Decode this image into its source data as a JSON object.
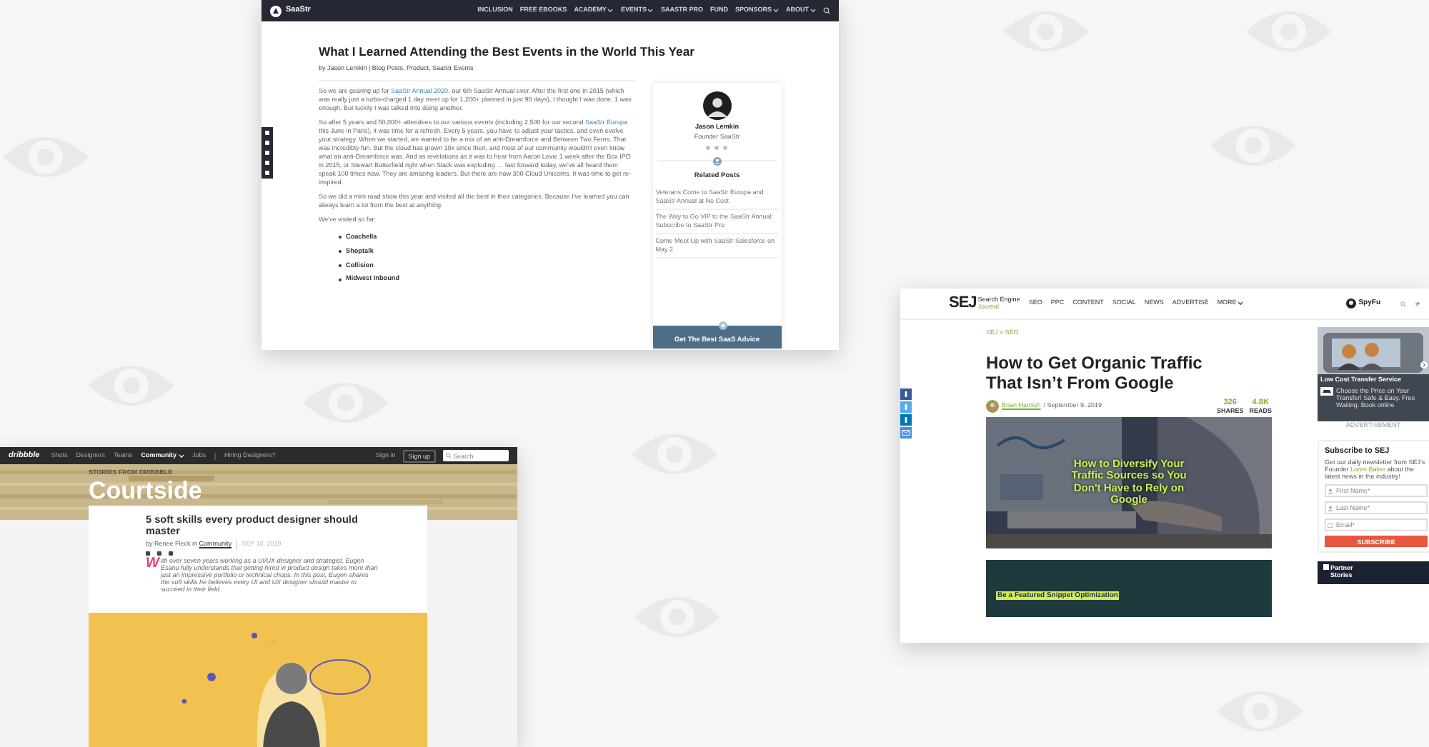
{
  "saastr": {
    "logo": "SaaStr",
    "nav": [
      {
        "label": "INCLUSION",
        "dropdown": false
      },
      {
        "label": "FREE EBOOKS",
        "dropdown": false
      },
      {
        "label": "ACADEMY",
        "dropdown": true
      },
      {
        "label": "EVENTS",
        "dropdown": true
      },
      {
        "label": "SAASTR PRO",
        "dropdown": false
      },
      {
        "label": "FUND",
        "dropdown": false
      },
      {
        "label": "SPONSORS",
        "dropdown": true
      },
      {
        "label": "ABOUT",
        "dropdown": true
      }
    ],
    "title": "What I Learned Attending the Best Events in the World This Year",
    "byline": "by Jason Lemkin | Blog Posts, Product, SaaStr Events",
    "paragraphs": [
      [
        {
          "text": "So we are gearing up for ",
          "link": false
        },
        {
          "text": "SaaStr Annual 2020",
          "link": true
        },
        {
          "text": ", our 6th SaaStr Annual ever.  After the first one in 2015 (which was really just a turbo-charged 1 day meet up for 1,200+ planned in just 90 days), I thought I was done.  1 was enough.  But luckily I was talked into doing another.",
          "link": false
        }
      ],
      [
        {
          "text": "So after 5 years and 50,000+ attendees to our various events (including 2,500 for our second ",
          "link": false
        },
        {
          "text": "SaaStr Europa",
          "link": true
        },
        {
          "text": " this June in Paris), it was time for a refresh.  Every 5 years, you have to adjust your tactics, and even evolve your strategy.  When we started, we wanted to be a mix of an anti-Dreamforce and Between Two Ferns.  That was incredibly fun.  But the cloud has grown 10x since then, and most of our community wouldn't even know what an anti-Dreamforce was.  And as revelations as it was to hear from Aaron Levie 1 week after the Box IPO in 2015, or Stewart Butterfield right when Slack was exploding … fast forward today, we've all heard them speak 100 times now.  They are amazing leaders.  But there are now 300 Cloud Unicorns.  It was time to get re-inspired.",
          "link": false
        }
      ],
      [
        {
          "text": "So we did a mini road show this year and visited all the best in their categories.  Because I've learned you can always learn a lot from the best at anything.",
          "link": false
        }
      ],
      [
        {
          "text": "We've visited so far:",
          "link": false
        }
      ]
    ],
    "list": [
      "Coachella",
      "Shoptalk",
      "Collision",
      "Midwest Inbound"
    ],
    "author": {
      "name": "Jason Lemkin",
      "role": "Founder SaaStr"
    },
    "related_title": "Related Posts",
    "related_posts": [
      "Veterans Come to SaaStr Europa and SaaStr Annual at No Cost",
      "The Way to Go VIP to the SaaStr Annual: Subscribe to SaaStr Pro",
      "Come Meet Up with SaaStr Salesforce on May 2"
    ],
    "banner": "Get The Best SaaS Advice"
  },
  "dribbble": {
    "logo": "dribbble",
    "nav": [
      {
        "label": "Shots",
        "selected": false,
        "dropdown": false
      },
      {
        "label": "Designers",
        "selected": false,
        "dropdown": false
      },
      {
        "label": "Teams",
        "selected": false,
        "dropdown": false
      },
      {
        "label": "Community",
        "selected": true,
        "dropdown": true
      },
      {
        "label": "Jobs",
        "selected": false,
        "dropdown": false
      },
      {
        "label": "Hiring Designers?",
        "selected": false,
        "dropdown": false
      }
    ],
    "sign_in": "Sign in",
    "sign_up": "Sign up",
    "search": {
      "placeholder": "Search"
    },
    "kicker": "STORIES FROM DRIBBBLE",
    "header": "Courtside",
    "title": "5 soft skills every product designer should master",
    "byline": [
      {
        "text": "by Renee Fleck in ",
        "link": false
      },
      {
        "text": "Community",
        "link": true
      }
    ],
    "date": "SEP 10, 2019",
    "drop_cap": "W",
    "intro": "ith over seven years working as a UI/UX designer and strategist, Eugen Esanu fully understands that getting hired in product design takes more than just an impressive portfolio or technical chops. In this post, Eugen shares the soft skills he believes every UI and UX designer should master to succeed in their field."
  },
  "sej": {
    "logo": "SEJ",
    "logo_sub": [
      "Search Engine",
      "Journal"
    ],
    "nav": [
      {
        "label": "SEO",
        "dropdown": false
      },
      {
        "label": "PPC",
        "dropdown": false
      },
      {
        "label": "CONTENT",
        "dropdown": false
      },
      {
        "label": "SOCIAL",
        "dropdown": false
      },
      {
        "label": "NEWS",
        "dropdown": false
      },
      {
        "label": "ADVERTISE",
        "dropdown": false
      },
      {
        "label": "MORE",
        "dropdown": true
      }
    ],
    "sponsor": "SpyFu",
    "category": "SEJ » SEO",
    "title": "How to Get Organic Traffic That Isn’t From Google",
    "author": "Brian Harnish",
    "date": "/ September 9, 2019",
    "stats": [
      {
        "value": "326",
        "label": "SHARES"
      },
      {
        "value": "4.8K",
        "label": "READS"
      }
    ],
    "hero_caption": "How to Diversify Your Traffic Sources so You Don't Have to Rely on Google",
    "section_heading": "Be a Featured Snippet Optimization",
    "ad": {
      "title": "Low Cost Transfer Service",
      "text": "Choose the Price on Your Transfer! Safe & Easy. Free Waiting. Book online",
      "label": "ADVERTISEMENT"
    },
    "subscribe": {
      "title": "Subscribe to SEJ",
      "text": [
        {
          "text": "Get our daily newsletter from SEJ's Founder ",
          "link": false
        },
        {
          "text": "Loren Baker",
          "link": true
        },
        {
          "text": " about the latest news in the industry!",
          "link": false
        }
      ],
      "fields": [
        {
          "placeholder": "First Name*",
          "kind": "person"
        },
        {
          "placeholder": "Last Name*",
          "kind": "person"
        },
        {
          "placeholder": "Email*",
          "kind": "email"
        }
      ],
      "button": "SUBSCRIBE"
    },
    "partner": [
      "Partner",
      "Stories"
    ]
  }
}
